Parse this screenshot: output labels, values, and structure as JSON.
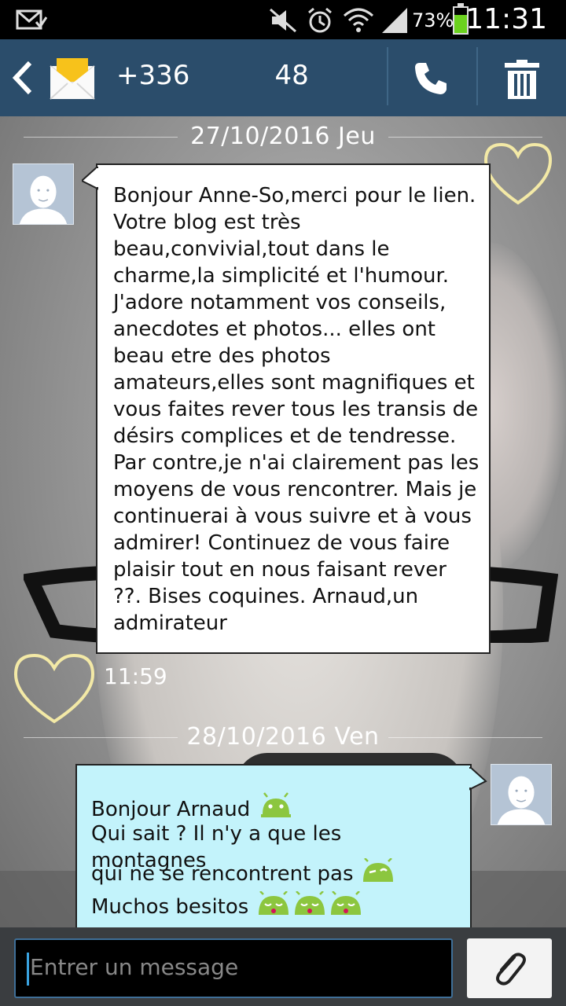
{
  "status_bar": {
    "time": "11:31",
    "battery_percent": "73%",
    "battery_level": 0.73,
    "icons": [
      "mail-check-icon",
      "mute-icon",
      "alarm-icon",
      "wifi-icon",
      "signal-icon",
      "battery-icon"
    ]
  },
  "header": {
    "contact_left": "+336",
    "contact_right": "48",
    "icons": [
      "back-icon",
      "message-envelope-icon",
      "call-icon",
      "trash-icon"
    ]
  },
  "conversation": {
    "day1": {
      "date": "27/10/2016 Jeu",
      "message": "Bonjour Anne-So,merci pour le lien. Votre blog est très beau,convivial,tout dans le charme,la simplicité et l'humour. J'adore notamment vos conseils, anecdotes et photos... elles ont beau etre des photos amateurs,elles sont magnifiques et vous faites rever tous les transis de désirs complices et de tendresse. Par contre,je n'ai clairement pas les moyens de vous rencontrer. Mais je continuerai à vous suivre et à vous admirer! Continuez de vous faire plaisir tout en nous faisant rever ??. Bises coquines. Arnaud,un admirateur",
      "time": "11:59"
    },
    "day2": {
      "date": "28/10/2016 Ven",
      "reply_line1": "Bonjour Arnaud",
      "reply_line2": "Qui sait ? Il n'y a que les montagnes",
      "reply_line3": "qui ne se rencontrent pas",
      "reply_line4": "Muchos besitos"
    }
  },
  "composer": {
    "placeholder": "Entrer un message",
    "icons": [
      "paperclip-icon"
    ]
  },
  "colors": {
    "action_bar": "#2b4d6b",
    "incoming_bubble": "#ffffff",
    "outgoing_bubble": "#c3f3fb",
    "emoji_green": "#8cc63f",
    "heart_outline": "#f3e9a6"
  }
}
